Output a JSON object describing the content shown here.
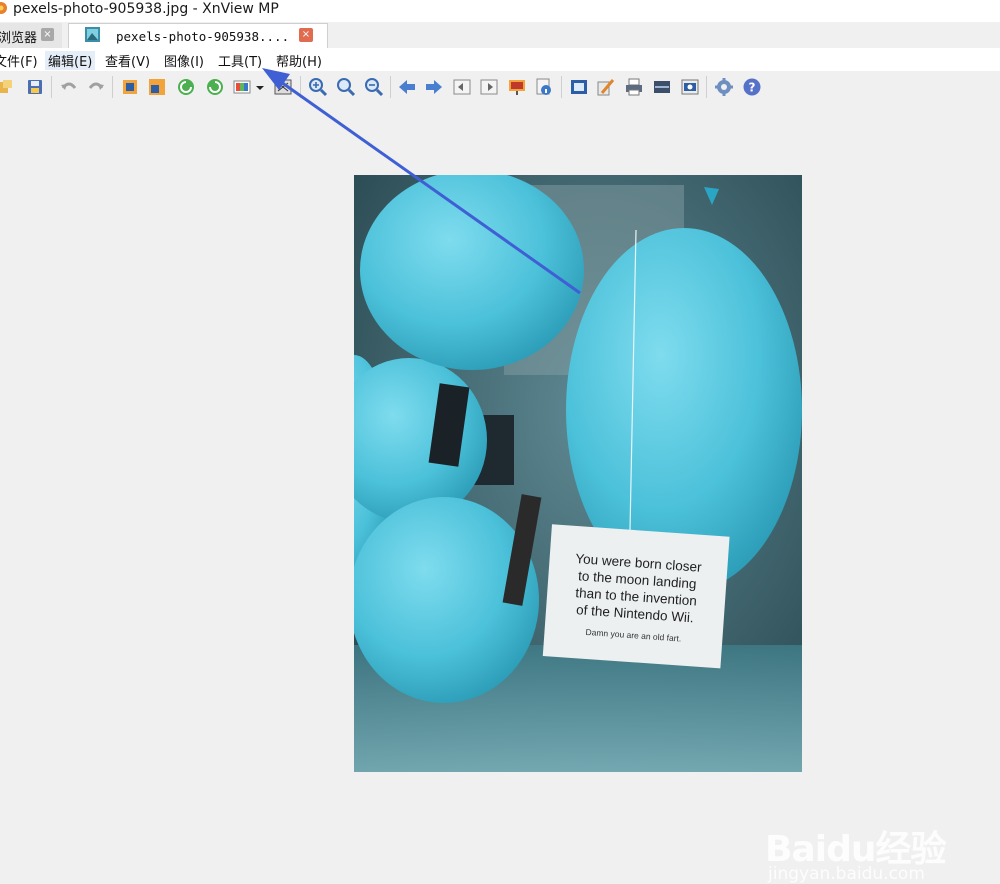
{
  "window": {
    "title": "pexels-photo-905938.jpg - XnView MP"
  },
  "tabs": [
    {
      "label": "浏览器",
      "close": "×"
    },
    {
      "label": "pexels-photo-905938....",
      "close": "×"
    }
  ],
  "menu": [
    {
      "label": "文件(F)"
    },
    {
      "label": "编辑(E)"
    },
    {
      "label": "查看(V)"
    },
    {
      "label": "图像(I)"
    },
    {
      "label": "工具(T)"
    },
    {
      "label": "帮助(H)"
    }
  ],
  "toolbar": {
    "buttons": [
      "open-icon",
      "save-icon",
      "undo-icon",
      "redo-icon",
      "crop-icon",
      "resize-icon",
      "rotate-left-icon",
      "rotate-right-icon",
      "color-adjust-icon",
      "dropdown-icon",
      "fullscreen-icon",
      "zoom-in-icon",
      "zoom-fit-icon",
      "zoom-out-icon",
      "prev-icon",
      "next-icon",
      "first-icon",
      "last-icon",
      "slideshow-icon",
      "info-icon",
      "fit-window-icon",
      "edit-icon",
      "print-icon",
      "scan-icon",
      "capture-icon",
      "settings-icon",
      "help-icon"
    ]
  },
  "image": {
    "card_lines": [
      "You were born closer",
      "to the moon landing",
      "than to the invention",
      "of the Nintendo Wii."
    ],
    "card_small": "Damn you are an old fart."
  },
  "watermark": {
    "logo": "Baidu经验",
    "url": "jingyan.baidu.com"
  },
  "colors": {
    "accent": "#3f5fd4",
    "tab_close": "#e06b4f",
    "balloon": "#4fc3dd"
  }
}
